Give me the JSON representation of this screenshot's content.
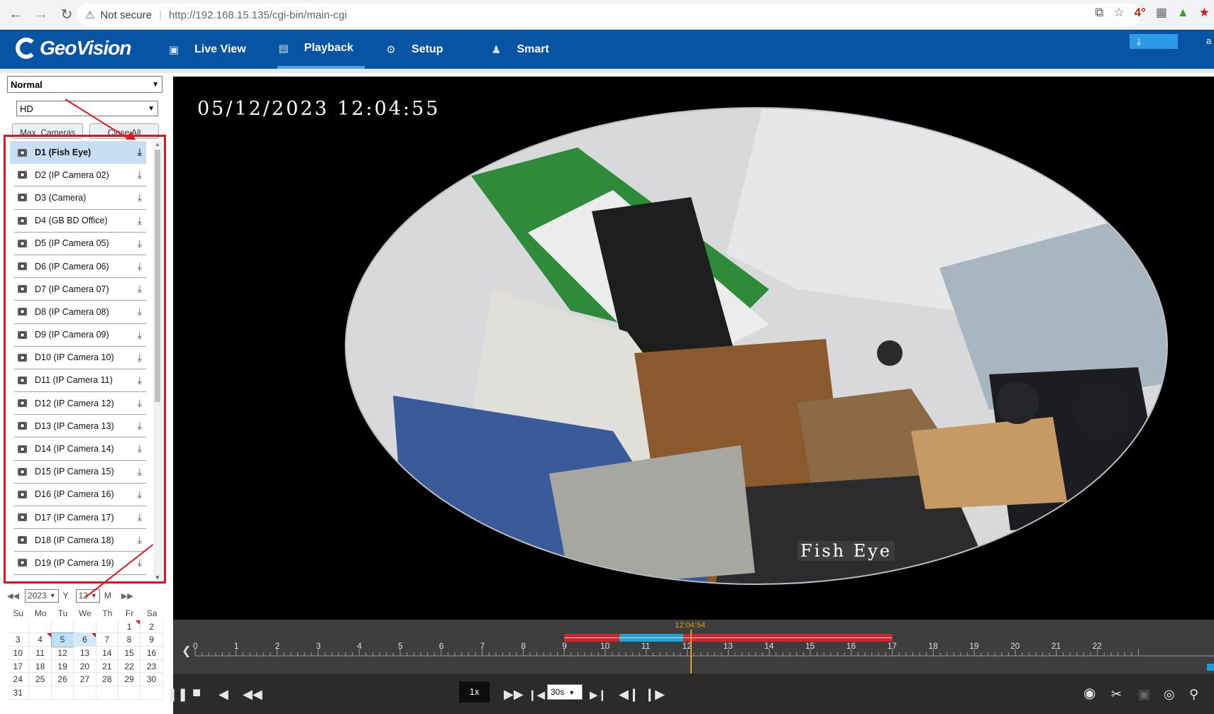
{
  "browser": {
    "security_label": "Not secure",
    "url": "http://192.168.15.135/cgi-bin/main-cgi",
    "weather_ext": "4°"
  },
  "app": {
    "logo": "GeoVision",
    "nav": [
      {
        "label": "Live View",
        "icon": "monitor-icon"
      },
      {
        "label": "Playback",
        "icon": "playback-grid-icon",
        "active": true
      },
      {
        "label": "Setup",
        "icon": "gear-icon"
      },
      {
        "label": "Smart",
        "icon": "user-search-icon"
      }
    ],
    "account_text": "a"
  },
  "left": {
    "mode_select": "Normal",
    "quality_select": "HD",
    "max_cameras_label": "Max. Cameras",
    "close_all_label": "Close All",
    "cameras": [
      "D1 (Fish Eye)",
      "D2 (IP Camera 02)",
      "D3 (Camera)",
      "D4 (GB BD Office)",
      "D5 (IP Camera 05)",
      "D6 (IP Camera 06)",
      "D7 (IP Camera 07)",
      "D8 (IP Camera 08)",
      "D9 (IP Camera 09)",
      "D10 (IP Camera 10)",
      "D11 (IP Camera 11)",
      "D12 (IP Camera 12)",
      "D13 (IP Camera 13)",
      "D14 (IP Camera 14)",
      "D15 (IP Camera 15)",
      "D16 (IP Camera 16)",
      "D17 (IP Camera 17)",
      "D18 (IP Camera 18)",
      "D19 (IP Camera 19)"
    ],
    "selected_camera_index": 0
  },
  "calendar": {
    "year": "2023",
    "year_label": "Y",
    "month": "12",
    "month_label": "M",
    "weekdays": [
      "Su",
      "Mo",
      "Tu",
      "We",
      "Th",
      "Fr",
      "Sa"
    ],
    "weeks": [
      [
        "",
        "",
        "",
        "",
        "",
        "1",
        "2"
      ],
      [
        "3",
        "4",
        "5",
        "6",
        "7",
        "8",
        "9"
      ],
      [
        "10",
        "11",
        "12",
        "13",
        "14",
        "15",
        "16"
      ],
      [
        "17",
        "18",
        "19",
        "20",
        "21",
        "22",
        "23"
      ],
      [
        "24",
        "25",
        "26",
        "27",
        "28",
        "29",
        "30"
      ],
      [
        "31",
        "",
        "",
        "",
        "",
        "",
        ""
      ]
    ],
    "recorded_days": [
      "1",
      "4",
      "6"
    ],
    "selected_day": "5",
    "highlighted_days": [
      "6"
    ]
  },
  "video": {
    "osd_timestamp": "05/12/2023 12:04:55",
    "osd_camera_name": "Fish Eye"
  },
  "timeline": {
    "cursor_label": "12:04:54",
    "cursor_hour": 12.08,
    "hours": [
      "0",
      "1",
      "2",
      "3",
      "4",
      "5",
      "6",
      "7",
      "8",
      "9",
      "10",
      "11",
      "12",
      "13",
      "14",
      "15",
      "16",
      "17",
      "18",
      "19",
      "20",
      "21",
      "22"
    ],
    "record_start_hour": 9,
    "record_end_hour": 17,
    "colors": {
      "record": "#d0262b",
      "event": "#1ea7d6",
      "cursor": "#e39d22"
    }
  },
  "controls": {
    "speed": "1x",
    "step": "30s"
  }
}
